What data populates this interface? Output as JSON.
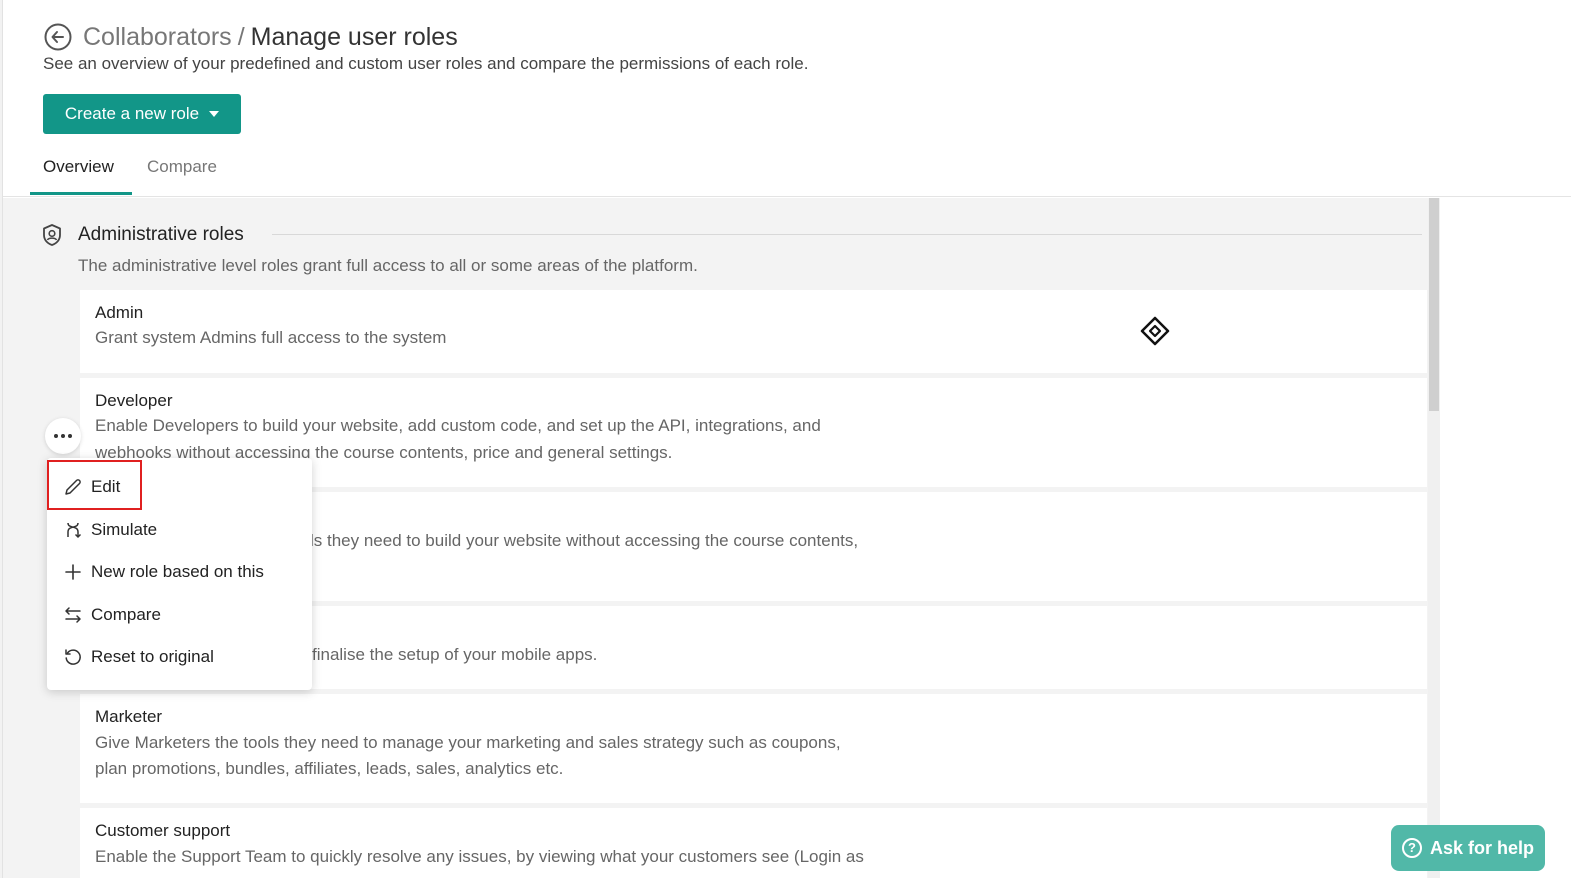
{
  "header": {
    "breadcrumb": "Collaborators",
    "separator": "/",
    "title": "Manage user roles",
    "subtitle": "See an overview of your predefined and custom user roles and compare the permissions of each role.",
    "create_button_label": "Create a new role"
  },
  "tabs": [
    {
      "label": "Overview",
      "active": true
    },
    {
      "label": "Compare",
      "active": false
    }
  ],
  "section": {
    "title": "Administrative roles",
    "description": "The administrative level roles grant full access to all or some areas of the platform."
  },
  "roles": [
    {
      "name": "Admin",
      "description": "Grant system Admins full access to the system"
    },
    {
      "name": "Developer",
      "description_line1": "Enable Developers to build your website, add custom code, and set up the API, integrations, and",
      "description_line2": "webhooks without accessing the course contents, price and general settings."
    },
    {
      "name": "",
      "description_partial": "ls they need to build your website without accessing the course contents,"
    },
    {
      "name": "",
      "description_partial": "finalise the setup of your mobile apps."
    },
    {
      "name": "Marketer",
      "description_line1": "Give Marketers the tools they need to manage your marketing and sales strategy such as coupons,",
      "description_line2": "plan promotions, bundles, affiliates, leads, sales, analytics etc."
    },
    {
      "name": "Customer support",
      "description_line1": "Enable the Support Team to quickly resolve any issues, by viewing what your customers see (Login as"
    }
  ],
  "context_menu": {
    "items": [
      {
        "label": "Edit",
        "icon": "pencil-icon",
        "highlighted": true
      },
      {
        "label": "Simulate",
        "icon": "simulate-icon"
      },
      {
        "label": "New role based on this",
        "icon": "plus-icon"
      },
      {
        "label": "Compare",
        "icon": "compare-arrows-icon"
      },
      {
        "label": "Reset to original",
        "icon": "reset-icon"
      }
    ]
  },
  "help_button": {
    "label": "Ask for help",
    "icon": "question-circle-icon"
  },
  "colors": {
    "accent": "#129688",
    "help": "#51b8a8",
    "highlight": "#e02020"
  }
}
